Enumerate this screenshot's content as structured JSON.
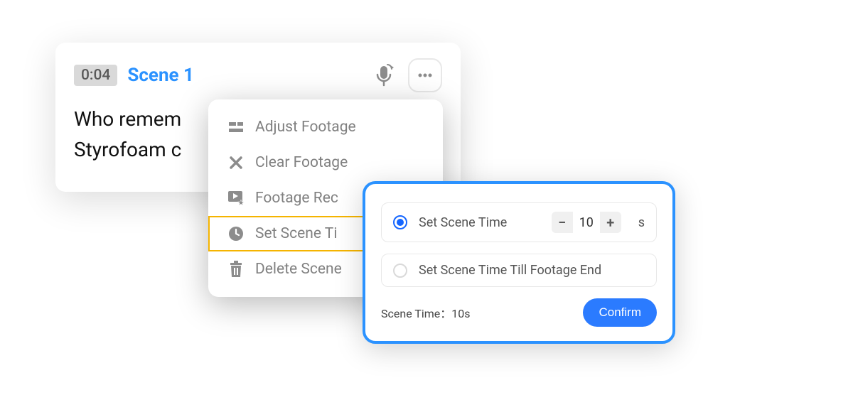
{
  "scene": {
    "timestamp": "0:04",
    "title": "Scene 1",
    "body": "Who remem\nStyrofoam c"
  },
  "menu": {
    "items": [
      {
        "label": "Adjust Footage",
        "icon": "sliders",
        "highlight": false
      },
      {
        "label": "Clear Footage",
        "icon": "close",
        "highlight": false
      },
      {
        "label": "Footage Rec",
        "icon": "play-star",
        "highlight": false
      },
      {
        "label": "Set Scene Ti",
        "icon": "clock",
        "highlight": true
      },
      {
        "label": "Delete Scene",
        "icon": "trash",
        "highlight": false
      }
    ]
  },
  "dialog": {
    "option_set_time_label": "Set Scene Time",
    "option_till_end_label": "Set Scene Time Till Footage End",
    "selected": "set_time",
    "stepper_value": "10",
    "unit": "s",
    "footer_text": "Scene Time：10s",
    "confirm_label": "Confirm"
  }
}
